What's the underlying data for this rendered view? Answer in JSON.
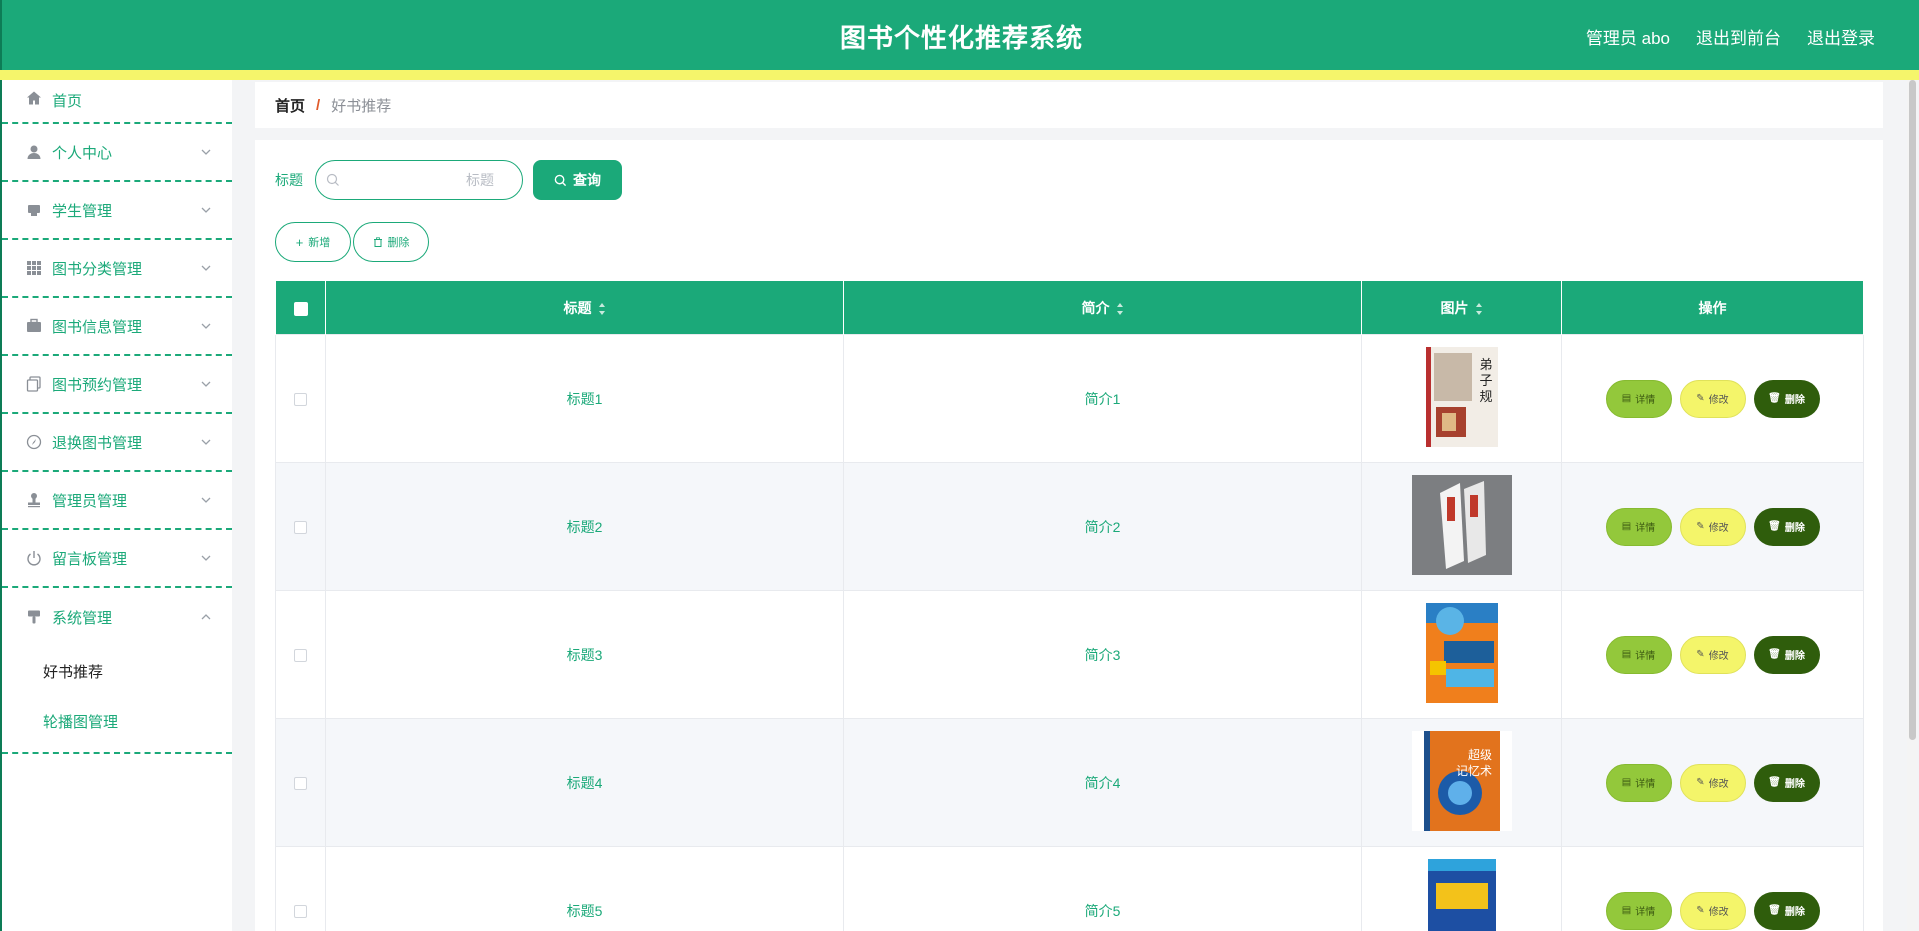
{
  "header": {
    "title": "图书个性化推荐系统",
    "user_label": "管理员 abo",
    "to_front": "退出到前台",
    "logout": "退出登录"
  },
  "sidebar": {
    "items": [
      {
        "label": "首页",
        "icon": "home-icon"
      },
      {
        "label": "个人中心",
        "icon": "user-icon"
      },
      {
        "label": "学生管理",
        "icon": "student-icon"
      },
      {
        "label": "图书分类管理",
        "icon": "grid-icon"
      },
      {
        "label": "图书信息管理",
        "icon": "briefcase-icon"
      },
      {
        "label": "图书预约管理",
        "icon": "copy-icon"
      },
      {
        "label": "退换图书管理",
        "icon": "compass-icon"
      },
      {
        "label": "管理员管理",
        "icon": "stamp-icon"
      },
      {
        "label": "留言板管理",
        "icon": "power-icon"
      },
      {
        "label": "系统管理",
        "icon": "brush-icon"
      }
    ],
    "sub_items": [
      "好书推荐",
      "轮播图管理"
    ]
  },
  "breadcrumb": {
    "home": "首页",
    "separator": "/",
    "current": "好书推荐"
  },
  "search": {
    "label": "标题",
    "placeholder": "标题",
    "value": "",
    "button": "查询"
  },
  "actions": {
    "add": "新增",
    "delete": "删除"
  },
  "table": {
    "headers": [
      "标题",
      "简介",
      "图片",
      "操作"
    ],
    "rows": [
      {
        "title": "标题1",
        "intro": "简介1"
      },
      {
        "title": "标题2",
        "intro": "简介2"
      },
      {
        "title": "标题3",
        "intro": "简介3"
      },
      {
        "title": "标题4",
        "intro": "简介4"
      },
      {
        "title": "标题5",
        "intro": "简介5"
      }
    ],
    "ops": {
      "detail": "详情",
      "edit": "修改",
      "delete": "删除"
    }
  },
  "colors": {
    "primary": "#1ba979",
    "accent_yellow": "#f5f56b",
    "detail": "#93c83b",
    "edit": "#f4f56a",
    "danger": "#2f5d0c"
  }
}
